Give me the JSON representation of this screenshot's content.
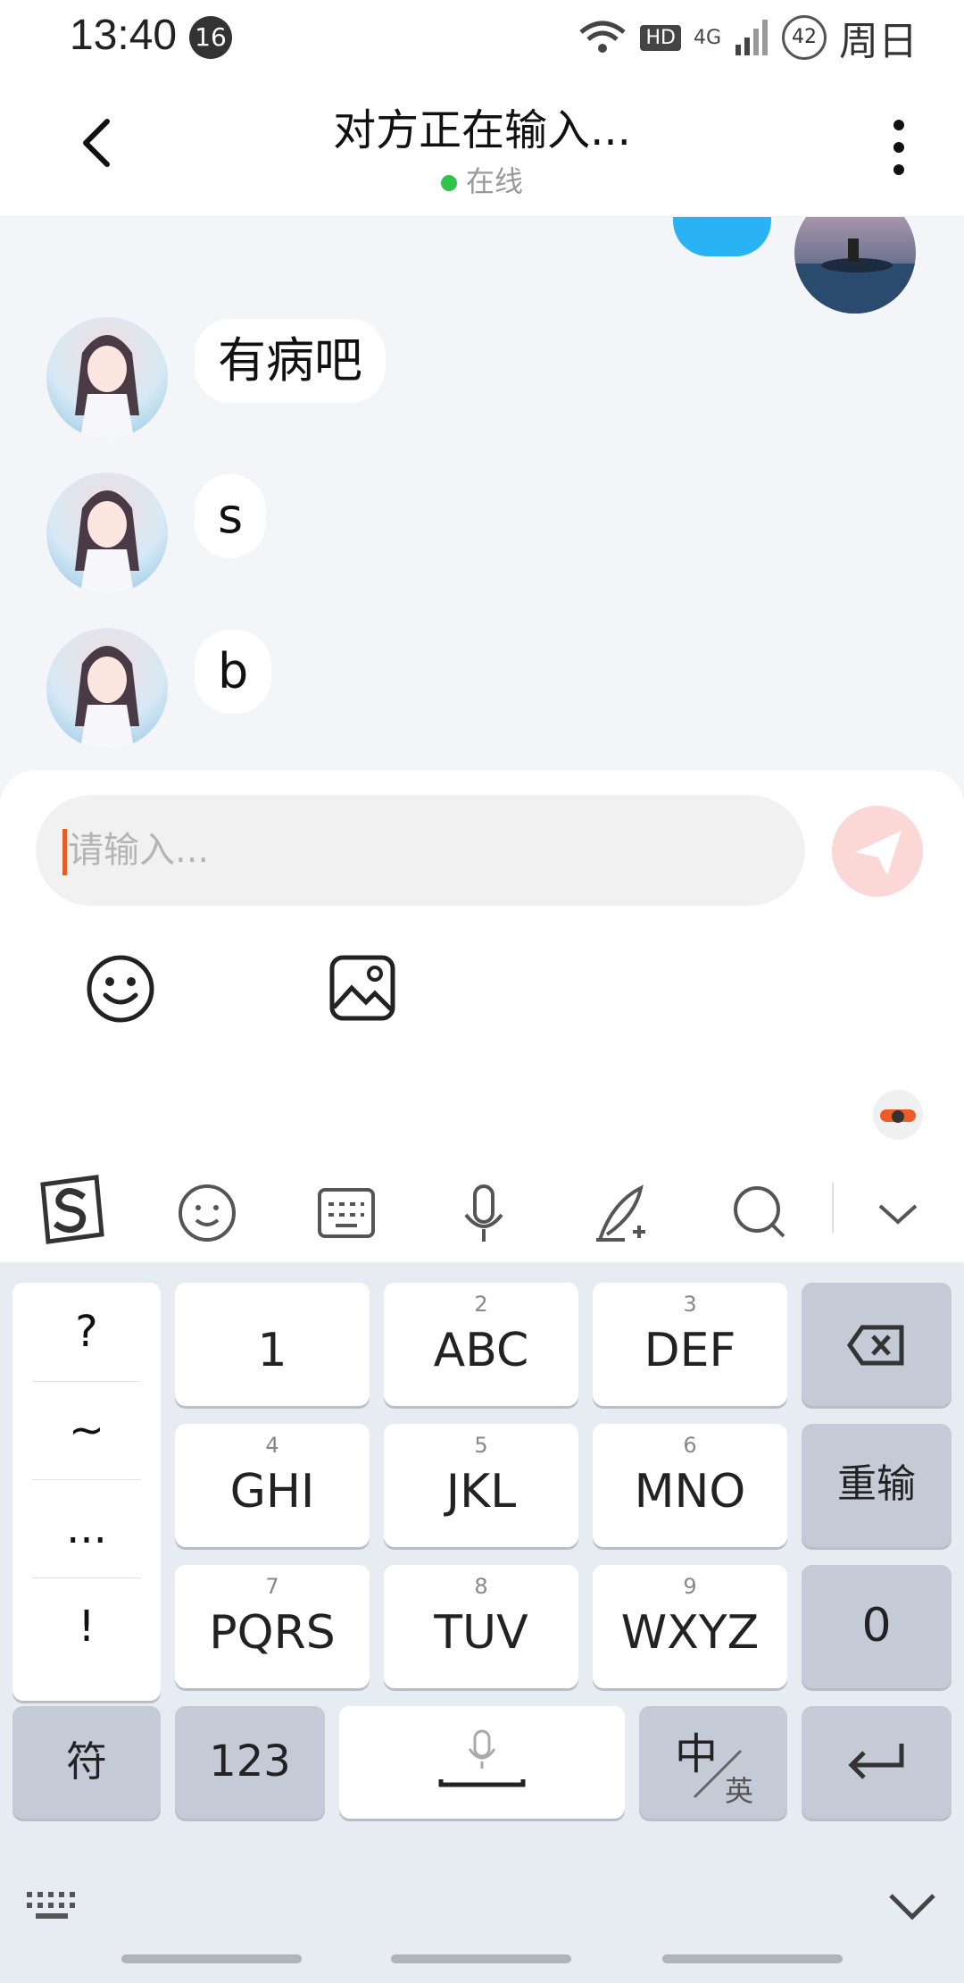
{
  "status_bar": {
    "time": "13:40",
    "notification_count": "16",
    "network_hd": "HD",
    "network_4g": "4G",
    "battery": "42",
    "day": "周日"
  },
  "header": {
    "title": "对方正在输入...",
    "status": "在线",
    "status_color": "#2fc34b"
  },
  "messages": [
    {
      "sender": "other",
      "text": "有病吧"
    },
    {
      "sender": "other",
      "text": "s"
    },
    {
      "sender": "other",
      "text": "b"
    }
  ],
  "input": {
    "placeholder": "请输入..."
  },
  "keyboard": {
    "symbols": [
      "?",
      "~",
      "...",
      "!"
    ],
    "rows": [
      [
        {
          "sub": "",
          "label": "1"
        },
        {
          "sub": "2",
          "label": "ABC"
        },
        {
          "sub": "3",
          "label": "DEF"
        }
      ],
      [
        {
          "sub": "4",
          "label": "GHI"
        },
        {
          "sub": "5",
          "label": "JKL"
        },
        {
          "sub": "6",
          "label": "MNO"
        }
      ],
      [
        {
          "sub": "7",
          "label": "PQRS"
        },
        {
          "sub": "8",
          "label": "TUV"
        },
        {
          "sub": "9",
          "label": "WXYZ"
        }
      ]
    ],
    "reinput": "重输",
    "zero": "0",
    "fu": "符",
    "num": "123",
    "zh": "中",
    "en": "英"
  },
  "icons": {
    "send": "send-icon",
    "emoji": "emoji-icon",
    "image": "image-icon",
    "accent": "#29b3f4"
  }
}
